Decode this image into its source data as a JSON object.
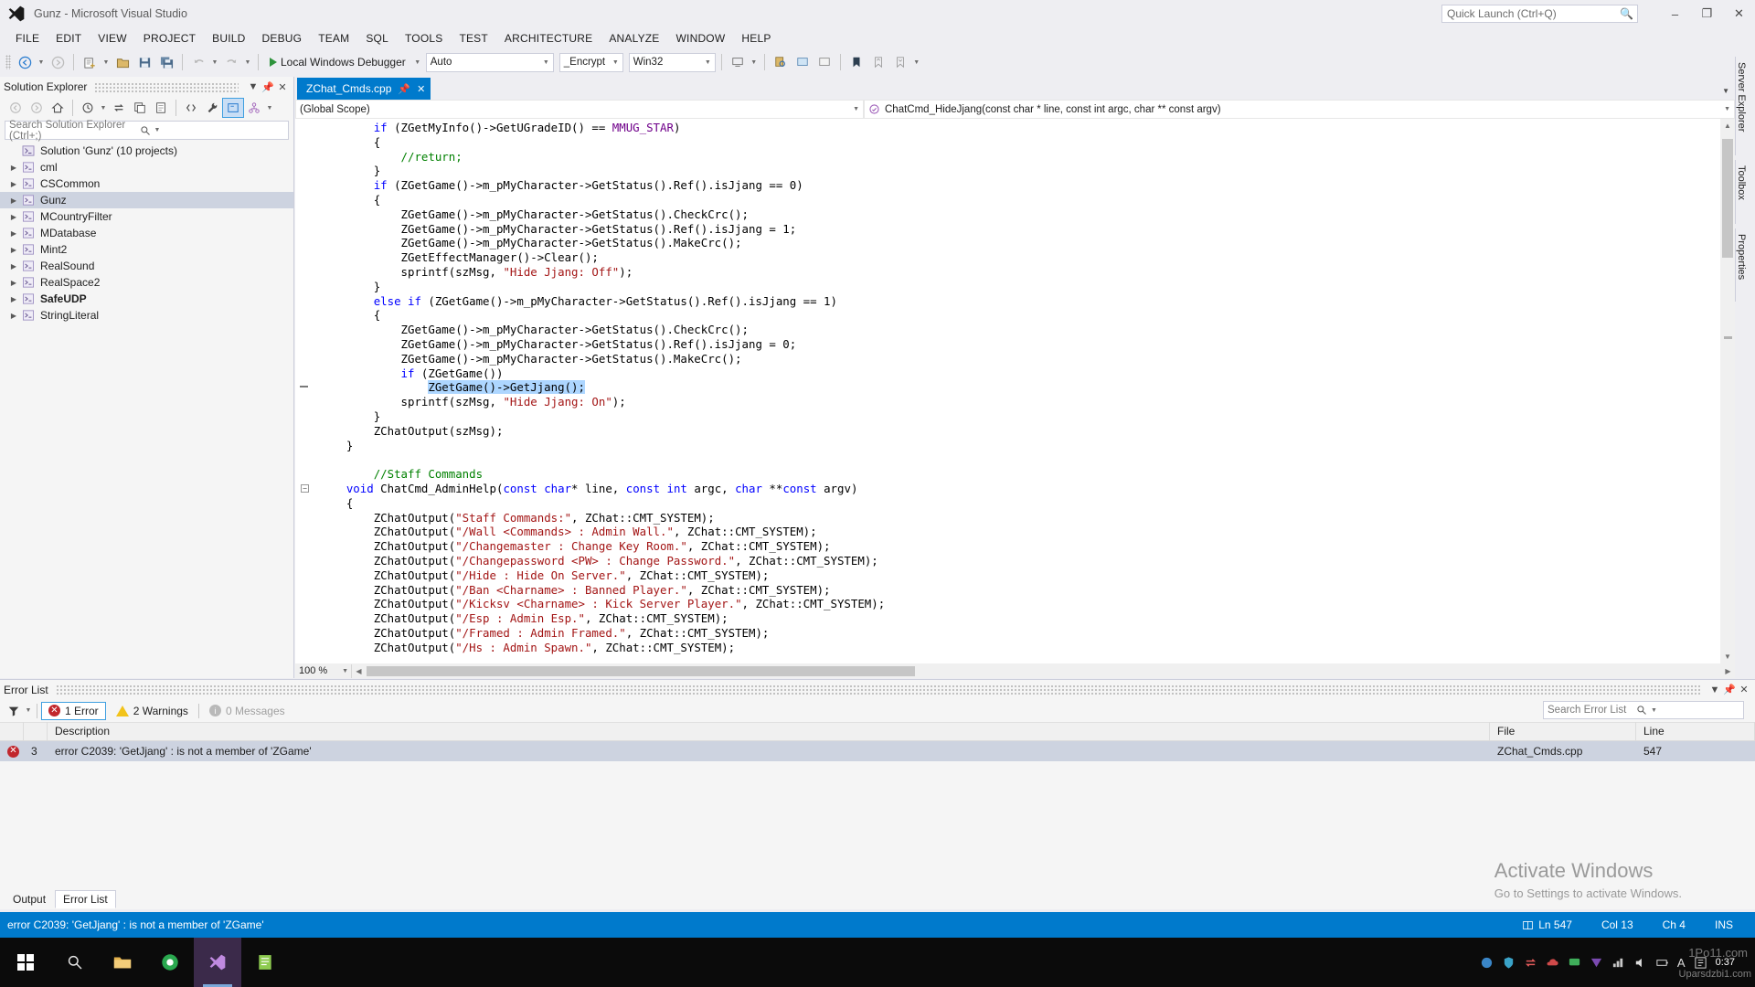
{
  "window": {
    "title": "Gunz - Microsoft Visual Studio",
    "logo_icon": "visual-studio-logo",
    "minimize": "–",
    "maximize": "❐",
    "close": "✕"
  },
  "quick_launch": {
    "placeholder": "Quick Launch (Ctrl+Q)",
    "icon": "search-icon"
  },
  "menu": [
    "FILE",
    "EDIT",
    "VIEW",
    "PROJECT",
    "BUILD",
    "DEBUG",
    "TEAM",
    "SQL",
    "TOOLS",
    "TEST",
    "ARCHITECTURE",
    "ANALYZE",
    "WINDOW",
    "HELP"
  ],
  "toolbar": {
    "debug_label": "Local Windows Debugger",
    "config_combo": "Auto",
    "platform_combo": "_Encrypt",
    "arch_combo": "Win32",
    "icons": [
      "navigate-back-icon",
      "navigate-forward-icon",
      "new-project-icon",
      "open-file-icon",
      "save-icon",
      "save-all-icon",
      "undo-icon",
      "redo-icon",
      "play-icon",
      "attach-icon",
      "step-into-icon",
      "step-over-icon",
      "step-out-icon",
      "breakpoint-icon",
      "toggle-bookmark-icon",
      "next-bookmark-icon",
      "prev-bookmark-icon",
      "more-icon"
    ]
  },
  "right_strips": [
    "Server Explorer",
    "Toolbox",
    "Properties"
  ],
  "solution_explorer": {
    "title": "Solution Explorer",
    "header_icons": [
      "chevron-down-icon",
      "pin-icon",
      "close-icon"
    ],
    "toolbar_icons": [
      "back-icon",
      "forward-icon",
      "home-icon",
      "pending-changes-icon",
      "sync-icon",
      "collapse-all-icon",
      "properties-window-icon",
      "show-all-files-icon",
      "wrench-icon",
      "solution-explorer-view-icon",
      "class-view-icon",
      "more-icon"
    ],
    "search_placeholder": "Search Solution Explorer (Ctrl+;)",
    "root": "Solution 'Gunz' (10 projects)",
    "root_icon": "solution-icon",
    "projects": [
      {
        "label": "cml",
        "selected": false,
        "bold": false
      },
      {
        "label": "CSCommon",
        "selected": false,
        "bold": false
      },
      {
        "label": "Gunz",
        "selected": true,
        "bold": false
      },
      {
        "label": "MCountryFilter",
        "selected": false,
        "bold": false
      },
      {
        "label": "MDatabase",
        "selected": false,
        "bold": false
      },
      {
        "label": "Mint2",
        "selected": false,
        "bold": false
      },
      {
        "label": "RealSound",
        "selected": false,
        "bold": false
      },
      {
        "label": "RealSpace2",
        "selected": false,
        "bold": false
      },
      {
        "label": "SafeUDP",
        "selected": false,
        "bold": true
      },
      {
        "label": "StringLiteral",
        "selected": false,
        "bold": false
      }
    ]
  },
  "editor": {
    "tab": {
      "label": "ZChat_Cmds.cpp",
      "pin_icon": "pin-icon",
      "close_icon": "close-icon"
    },
    "scope_combo": "(Global Scope)",
    "member_combo": "ChatCmd_HideJjang(const char * line, const int argc, char ** const argv)",
    "member_icon": "method-icon",
    "zoom": "100 %",
    "code_lines": [
      {
        "indent": 2,
        "segments": [
          {
            "t": "if",
            "c": "kw"
          },
          {
            "t": " (ZGetMyInfo()->GetUGradeID() == ",
            "c": ""
          },
          {
            "t": "MMUG_STAR",
            "c": "mac"
          },
          {
            "t": ")",
            "c": ""
          }
        ]
      },
      {
        "indent": 2,
        "segments": [
          {
            "t": "{",
            "c": ""
          }
        ]
      },
      {
        "indent": 3,
        "segments": [
          {
            "t": "//return;",
            "c": "cmt"
          }
        ]
      },
      {
        "indent": 2,
        "segments": [
          {
            "t": "}",
            "c": ""
          }
        ]
      },
      {
        "indent": 2,
        "segments": [
          {
            "t": "if",
            "c": "kw"
          },
          {
            "t": " (ZGetGame()->m_pMyCharacter->GetStatus().Ref().isJjang == 0)",
            "c": ""
          }
        ]
      },
      {
        "indent": 2,
        "segments": [
          {
            "t": "{",
            "c": ""
          }
        ]
      },
      {
        "indent": 3,
        "segments": [
          {
            "t": "ZGetGame()->m_pMyCharacter->GetStatus().CheckCrc();",
            "c": ""
          }
        ]
      },
      {
        "indent": 3,
        "segments": [
          {
            "t": "ZGetGame()->m_pMyCharacter->GetStatus().Ref().isJjang = 1;",
            "c": ""
          }
        ]
      },
      {
        "indent": 3,
        "segments": [
          {
            "t": "ZGetGame()->m_pMyCharacter->GetStatus().MakeCrc();",
            "c": ""
          }
        ]
      },
      {
        "indent": 3,
        "segments": [
          {
            "t": "ZGetEffectManager()->Clear();",
            "c": ""
          }
        ]
      },
      {
        "indent": 3,
        "segments": [
          {
            "t": "sprintf(szMsg, ",
            "c": ""
          },
          {
            "t": "\"Hide Jjang: Off\"",
            "c": "str"
          },
          {
            "t": ");",
            "c": ""
          }
        ]
      },
      {
        "indent": 2,
        "segments": [
          {
            "t": "}",
            "c": ""
          }
        ]
      },
      {
        "indent": 2,
        "segments": [
          {
            "t": "else if",
            "c": "kw"
          },
          {
            "t": " (ZGetGame()->m_pMyCharacter->GetStatus().Ref().isJjang == 1)",
            "c": ""
          }
        ]
      },
      {
        "indent": 2,
        "segments": [
          {
            "t": "{",
            "c": ""
          }
        ]
      },
      {
        "indent": 3,
        "segments": [
          {
            "t": "ZGetGame()->m_pMyCharacter->GetStatus().CheckCrc();",
            "c": ""
          }
        ]
      },
      {
        "indent": 3,
        "segments": [
          {
            "t": "ZGetGame()->m_pMyCharacter->GetStatus().Ref().isJjang = 0;",
            "c": ""
          }
        ]
      },
      {
        "indent": 3,
        "segments": [
          {
            "t": "ZGetGame()->m_pMyCharacter->GetStatus().MakeCrc();",
            "c": ""
          }
        ]
      },
      {
        "indent": 3,
        "segments": [
          {
            "t": "if",
            "c": "kw"
          },
          {
            "t": " (ZGetGame())",
            "c": ""
          }
        ]
      },
      {
        "indent": 4,
        "marker": "collapse",
        "segments": [
          {
            "t": "ZGetGame()->GetJjang();",
            "c": "sel"
          }
        ]
      },
      {
        "indent": 3,
        "segments": [
          {
            "t": "sprintf(szMsg, ",
            "c": ""
          },
          {
            "t": "\"Hide Jjang: On\"",
            "c": "str"
          },
          {
            "t": ");",
            "c": ""
          }
        ]
      },
      {
        "indent": 2,
        "segments": [
          {
            "t": "}",
            "c": ""
          }
        ]
      },
      {
        "indent": 2,
        "segments": [
          {
            "t": "ZChatOutput(szMsg);",
            "c": ""
          }
        ]
      },
      {
        "indent": 1,
        "segments": [
          {
            "t": "}",
            "c": ""
          }
        ]
      },
      {
        "indent": 0,
        "segments": []
      },
      {
        "indent": 2,
        "segments": [
          {
            "t": "//Staff Commands",
            "c": "cmt"
          }
        ]
      },
      {
        "indent": 1,
        "fold": true,
        "segments": [
          {
            "t": "void",
            "c": "kw"
          },
          {
            "t": " ChatCmd_AdminHelp(",
            "c": ""
          },
          {
            "t": "const char",
            "c": "kw"
          },
          {
            "t": "* line, ",
            "c": ""
          },
          {
            "t": "const int",
            "c": "kw"
          },
          {
            "t": " argc, ",
            "c": ""
          },
          {
            "t": "char",
            "c": "kw"
          },
          {
            "t": " **",
            "c": ""
          },
          {
            "t": "const",
            "c": "kw"
          },
          {
            "t": " argv)",
            "c": ""
          }
        ]
      },
      {
        "indent": 1,
        "segments": [
          {
            "t": "{",
            "c": ""
          }
        ]
      },
      {
        "indent": 2,
        "segments": [
          {
            "t": "ZChatOutput(",
            "c": ""
          },
          {
            "t": "\"Staff Commands:\"",
            "c": "str"
          },
          {
            "t": ", ZChat::CMT_SYSTEM);",
            "c": ""
          }
        ]
      },
      {
        "indent": 2,
        "segments": [
          {
            "t": "ZChatOutput(",
            "c": ""
          },
          {
            "t": "\"/Wall <Commands> : Admin Wall.\"",
            "c": "str"
          },
          {
            "t": ", ZChat::CMT_SYSTEM);",
            "c": ""
          }
        ]
      },
      {
        "indent": 2,
        "segments": [
          {
            "t": "ZChatOutput(",
            "c": ""
          },
          {
            "t": "\"/Changemaster : Change Key Room.\"",
            "c": "str"
          },
          {
            "t": ", ZChat::CMT_SYSTEM);",
            "c": ""
          }
        ]
      },
      {
        "indent": 2,
        "segments": [
          {
            "t": "ZChatOutput(",
            "c": ""
          },
          {
            "t": "\"/Changepassword <PW> : Change Password.\"",
            "c": "str"
          },
          {
            "t": ", ZChat::CMT_SYSTEM);",
            "c": ""
          }
        ]
      },
      {
        "indent": 2,
        "segments": [
          {
            "t": "ZChatOutput(",
            "c": ""
          },
          {
            "t": "\"/Hide : Hide On Server.\"",
            "c": "str"
          },
          {
            "t": ", ZChat::CMT_SYSTEM);",
            "c": ""
          }
        ]
      },
      {
        "indent": 2,
        "segments": [
          {
            "t": "ZChatOutput(",
            "c": ""
          },
          {
            "t": "\"/Ban <Charname> : Banned Player.\"",
            "c": "str"
          },
          {
            "t": ", ZChat::CMT_SYSTEM);",
            "c": ""
          }
        ]
      },
      {
        "indent": 2,
        "segments": [
          {
            "t": "ZChatOutput(",
            "c": ""
          },
          {
            "t": "\"/Kicksv <Charname> : Kick Server Player.\"",
            "c": "str"
          },
          {
            "t": ", ZChat::CMT_SYSTEM);",
            "c": ""
          }
        ]
      },
      {
        "indent": 2,
        "segments": [
          {
            "t": "ZChatOutput(",
            "c": ""
          },
          {
            "t": "\"/Esp : Admin Esp.\"",
            "c": "str"
          },
          {
            "t": ", ZChat::CMT_SYSTEM);",
            "c": ""
          }
        ]
      },
      {
        "indent": 2,
        "segments": [
          {
            "t": "ZChatOutput(",
            "c": ""
          },
          {
            "t": "\"/Framed : Admin Framed.\"",
            "c": "str"
          },
          {
            "t": ", ZChat::CMT_SYSTEM);",
            "c": ""
          }
        ]
      },
      {
        "indent": 2,
        "segments": [
          {
            "t": "ZChatOutput(",
            "c": ""
          },
          {
            "t": "\"/Hs : Admin Spawn.\"",
            "c": "str"
          },
          {
            "t": ", ZChat::CMT_SYSTEM);",
            "c": ""
          }
        ]
      }
    ]
  },
  "error_list": {
    "title": "Error List",
    "header_icons": [
      "chevron-down-icon",
      "pin-icon",
      "close-icon"
    ],
    "filter_icon": "filter-icon",
    "errors_label": "1 Error",
    "warnings_label": "2 Warnings",
    "messages_label": "0 Messages",
    "search_placeholder": "Search Error List",
    "columns": [
      "",
      "",
      "Description",
      "File",
      "Line"
    ],
    "rows": [
      {
        "icon": "error-icon",
        "num": "3",
        "description": "error C2039: 'GetJjang' : is not a member of 'ZGame'",
        "file": "ZChat_Cmds.cpp",
        "line": "547"
      }
    ]
  },
  "bottom_tabs": [
    {
      "label": "Output",
      "active": false
    },
    {
      "label": "Error List",
      "active": true
    }
  ],
  "activate_windows": {
    "heading": "Activate Windows",
    "sub": "Go to Settings to activate Windows."
  },
  "status_bar": {
    "message": "error C2039: 'GetJjang' : is not a member of 'ZGame'",
    "line": "Ln 547",
    "col": "Col 13",
    "ch": "Ch 4",
    "ins": "INS",
    "book_icon": "book-icon"
  },
  "taskbar": {
    "start_icon": "windows-start-icon",
    "apps": [
      "search-icon",
      "file-explorer-icon",
      "browser-icon",
      "visual-studio-icon",
      "notepad-icon"
    ],
    "tray_icons": [
      "network-icon",
      "shield-icon",
      "sync-icon",
      "cloud-icon",
      "chat-icon",
      "vpn-icon",
      "volume-icon",
      "keyboard-icon",
      "ime-A-icon",
      "settings-icon"
    ],
    "clock": "0:37"
  },
  "watermarks": {
    "top": "1Po11.com",
    "bottom": "Uparsdzbi1.com"
  },
  "colors": {
    "accent": "#007acc",
    "chrome": "#eeeef2",
    "selection": "#add6ff",
    "keyword": "#0000ff",
    "string": "#a31515",
    "comment": "#008000",
    "macro": "#6f008a",
    "error": "#c1272d",
    "warning": "#f2c31a",
    "row_selected": "#cdd3e0"
  }
}
